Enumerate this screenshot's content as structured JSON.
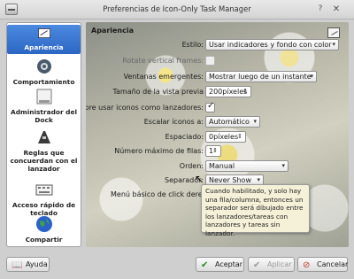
{
  "window": {
    "title": "Preferencias de Icon-Only Task Manager",
    "help_glyph": "?",
    "close_glyph": "✕"
  },
  "sidebar": {
    "items": [
      {
        "label": "Apariencia",
        "icon": "appearance-icon",
        "active": true
      },
      {
        "label": "Comportamiento",
        "icon": "gear-icon",
        "active": false
      },
      {
        "label": "Administrador del Dock",
        "icon": "dock-manager-icon",
        "active": false
      },
      {
        "label": "Reglas que concuerdan con el lanzador",
        "icon": "rules-icon",
        "active": false
      },
      {
        "label": "Acceso rápido de teclado",
        "icon": "keyboard-icon",
        "active": false
      },
      {
        "label": "Compartir",
        "icon": "globe-icon",
        "active": false
      }
    ]
  },
  "main": {
    "heading": "Apariencia",
    "fields": {
      "estilo": {
        "label": "Estilo:",
        "value": "Usar indicadores y fondo con color"
      },
      "rotate": {
        "label": "Rotate vertical frames:",
        "checked": false,
        "disabled": true
      },
      "ventanas": {
        "label": "Ventanas emergentes:",
        "value": "Mostrar luego de un instante"
      },
      "tamano": {
        "label": "Tamaño de la vista previa",
        "value": "200píxeles"
      },
      "siempre": {
        "label": "Siempre usar iconos como lanzadores:",
        "checked": true
      },
      "escalar": {
        "label": "Escalar íconos a:",
        "value": "Automático"
      },
      "espaciado": {
        "label": "Espaciado:",
        "value": "0píxeles"
      },
      "filas": {
        "label": "Número máximo de filas:",
        "value": "1"
      },
      "orden": {
        "label": "Orden:",
        "value": "Manual"
      },
      "separador": {
        "label": "Separador:",
        "value": "Never Show"
      },
      "menu": {
        "label": "Menú básico de click derecho"
      }
    },
    "tooltip": "Cuando habilitado, y solo hay una fila/columna, entonces un separador será dibujado entre los lanzadores/tareas con lanzadores y tareas sin lanzador."
  },
  "footer": {
    "help": "Ayuda",
    "accept": "Aceptar",
    "apply": "Aplicar",
    "cancel": "Cancelar"
  },
  "colors": {
    "accent": "#2c66c4",
    "tooltip_bg": "#f5f1d8"
  }
}
